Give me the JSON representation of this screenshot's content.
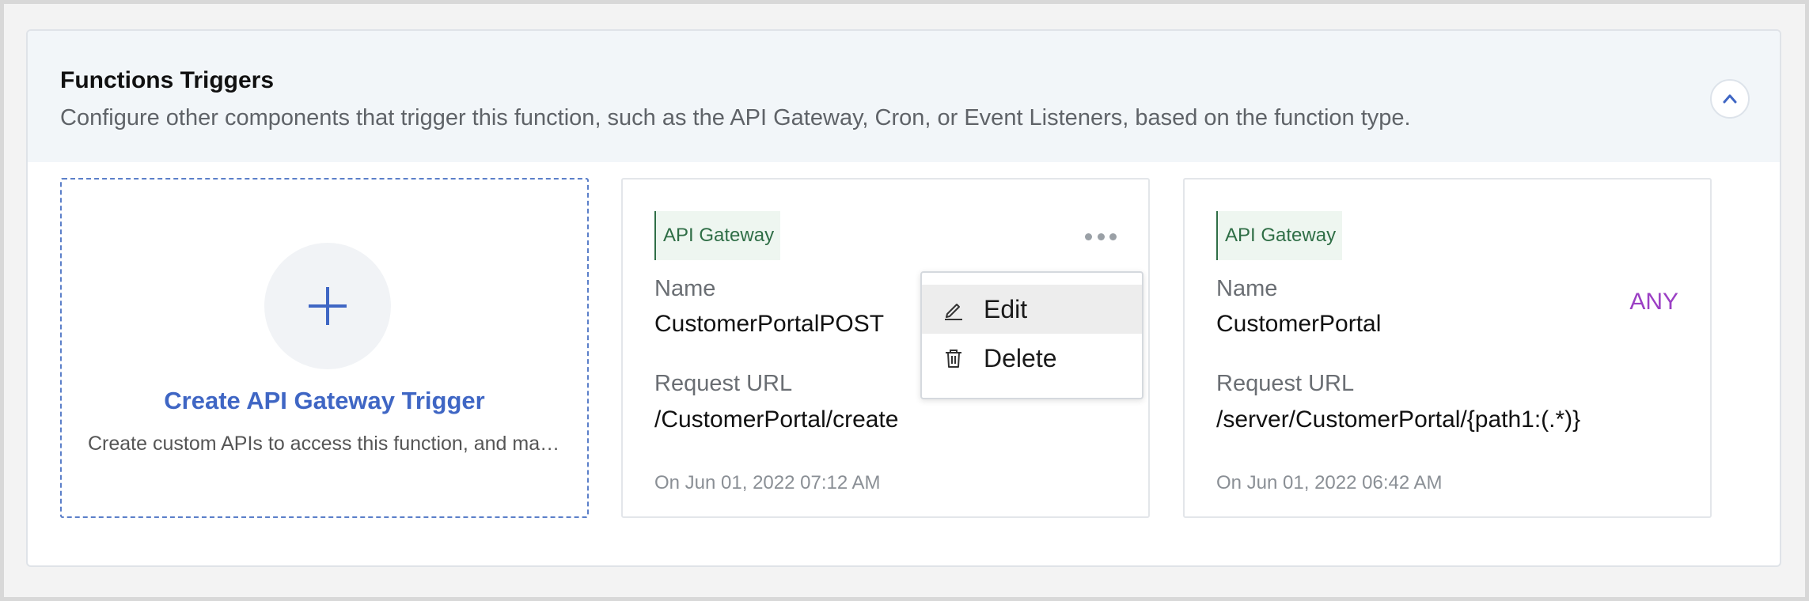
{
  "section": {
    "title": "Functions Triggers",
    "description": "Configure other components that trigger this function, such as the API Gateway, Cron, or Event Listeners, based on the function type.",
    "collapse_icon": "chevron-up-icon"
  },
  "create_card": {
    "icon": "plus-icon",
    "title": "Create API Gateway Trigger",
    "description": "Create custom APIs to access this function, and make them available to your users."
  },
  "triggers": [
    {
      "badge": "API Gateway",
      "name_label": "Name",
      "name": "CustomerPortalPOST",
      "url_label": "Request URL",
      "url": "/CustomerPortal/create",
      "date": "On Jun 01, 2022 07:12 AM",
      "method": ""
    },
    {
      "badge": "API Gateway",
      "name_label": "Name",
      "name": "CustomerPortal",
      "url_label": "Request URL",
      "url": "/server/CustomerPortal/{path1:(.*)}",
      "date": "On Jun 01, 2022 06:42 AM",
      "method": "ANY"
    }
  ],
  "context_menu": {
    "items": [
      {
        "label": "Edit",
        "icon": "pencil-icon"
      },
      {
        "label": "Delete",
        "icon": "trash-icon"
      }
    ]
  },
  "colors": {
    "accent": "#3f66c4",
    "badge_text": "#2f6e46",
    "badge_bg": "#eef6f0",
    "method": "#9b3fc4",
    "header_bg": "#f2f6f9"
  }
}
